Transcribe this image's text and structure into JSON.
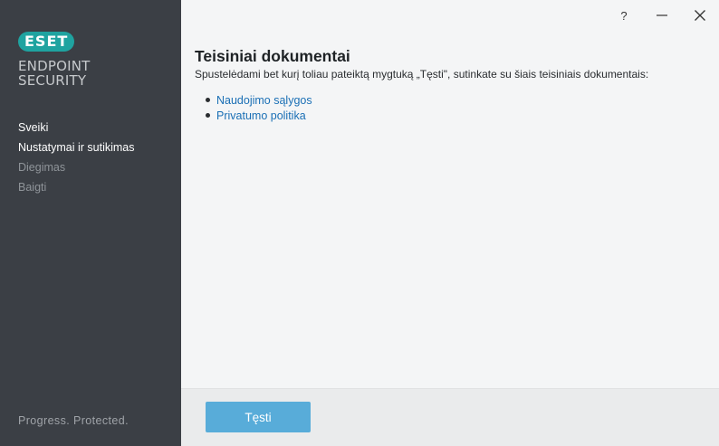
{
  "brand": {
    "logo_text": "ESET",
    "product_line1": "ENDPOINT",
    "product_line2": "SECURITY",
    "tagline": "Progress. Protected.",
    "accent_color": "#1fa3a0"
  },
  "window_controls": {
    "help": "?",
    "minimize": "—",
    "close": "✕"
  },
  "steps": [
    {
      "label": "Sveiki",
      "state": "active"
    },
    {
      "label": "Nustatymai ir sutikimas",
      "state": "active"
    },
    {
      "label": "Diegimas",
      "state": "inactive"
    },
    {
      "label": "Baigti",
      "state": "inactive"
    }
  ],
  "main": {
    "title": "Teisiniai dokumentai",
    "description": "Spustelėdami bet kurį toliau pateiktą mygtuką „Tęsti\", sutinkate su šiais teisiniais dokumentais:",
    "links": [
      {
        "label": "Naudojimo sąlygos"
      },
      {
        "label": "Privatumo politika"
      }
    ]
  },
  "footer": {
    "continue_label": "Tęsti",
    "button_color": "#58acd9"
  }
}
